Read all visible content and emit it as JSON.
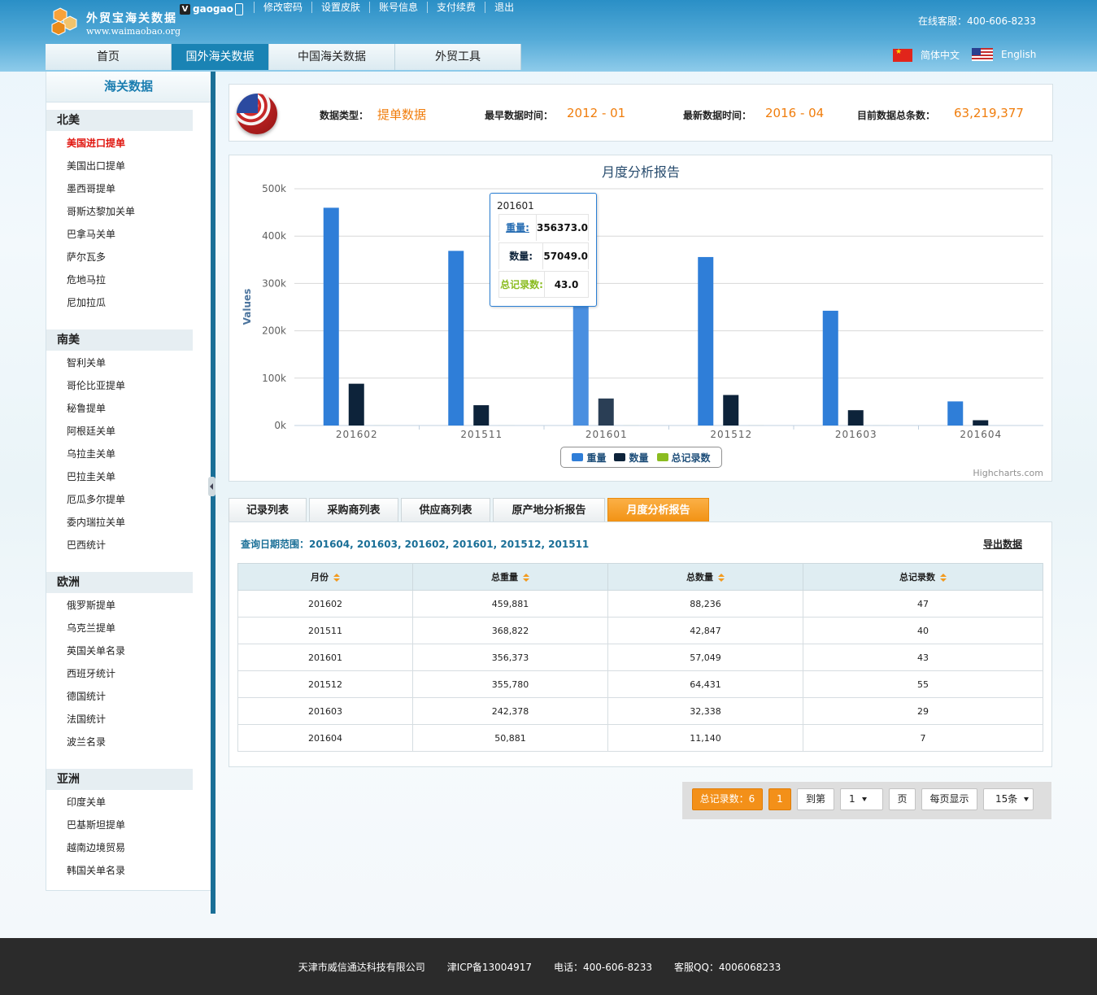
{
  "header": {
    "logo_title": "外贸宝海关数据",
    "logo_url": "www.waimaobao.org",
    "username": "gaogao",
    "user_badge": "V",
    "links": [
      "修改密码",
      "设置皮肤",
      "账号信息",
      "支付续费",
      "退出"
    ],
    "service": "在线客服：400-606-8233",
    "nav": [
      "首页",
      "国外海关数据",
      "中国海关数据",
      "外贸工具"
    ],
    "lang_cn": "简体中文",
    "lang_en": "English"
  },
  "sidebar": {
    "title": "海关数据",
    "regions": [
      {
        "name": "北美",
        "items": [
          "美国进口提单",
          "美国出口提单",
          "墨西哥提单",
          "哥斯达黎加关单",
          "巴拿马关单",
          "萨尔瓦多",
          "危地马拉",
          "尼加拉瓜"
        ]
      },
      {
        "name": "南美",
        "items": [
          "智利关单",
          "哥伦比亚提单",
          "秘鲁提单",
          "阿根廷关单",
          "乌拉圭关单",
          "巴拉圭关单",
          "厄瓜多尔提单",
          "委内瑞拉关单",
          "巴西统计"
        ]
      },
      {
        "name": "欧洲",
        "items": [
          "俄罗斯提单",
          "乌克兰提单",
          "英国关单名录",
          "西班牙统计",
          "德国统计",
          "法国统计",
          "波兰名录"
        ]
      },
      {
        "name": "亚洲",
        "items": [
          "印度关单",
          "巴基斯坦提单",
          "越南边境贸易",
          "韩国关单名录"
        ]
      }
    ]
  },
  "info": {
    "type_label": "数据类型：",
    "type_value": "提单数据",
    "earliest_label": "最早数据时间：",
    "earliest_value": "2012 - 01",
    "latest_label": "最新数据时间：",
    "latest_value": "2016 - 04",
    "total_label": "目前数据总条数：",
    "total_value": "63,219,377"
  },
  "chart_data": {
    "type": "bar",
    "title": "月度分析报告",
    "ylabel": "Values",
    "xlabel": "",
    "categories": [
      "201602",
      "201511",
      "201601",
      "201512",
      "201603",
      "201604"
    ],
    "ylim": [
      0,
      500000
    ],
    "yticks": [
      "0k",
      "100k",
      "200k",
      "300k",
      "400k",
      "500k"
    ],
    "series": [
      {
        "name": "重量",
        "values": [
          459881,
          368822,
          356373,
          355780,
          242378,
          50881
        ]
      },
      {
        "name": "数量",
        "values": [
          88236,
          42847,
          57049,
          64431,
          32338,
          11140
        ]
      },
      {
        "name": "总记录数",
        "values": [
          47,
          40,
          43,
          55,
          29,
          7
        ]
      }
    ],
    "grid": true,
    "legend": "bottom-center",
    "credits": "Highcharts.com"
  },
  "tooltip": {
    "title": "201601",
    "rows": [
      {
        "label": "重量:",
        "value": "356373.0"
      },
      {
        "label": "数量:",
        "value": "57049.0"
      },
      {
        "label": "总记录数:",
        "value": "43.0"
      }
    ]
  },
  "colors": {
    "weight": "#2f7ed8",
    "qty": "#0d233a",
    "records": "#8bbc21",
    "accent": "#f39019",
    "brand": "#1a83b4"
  },
  "tabs": [
    "记录列表",
    "采购商列表",
    "供应商列表",
    "原产地分析报告",
    "月度分析报告"
  ],
  "list": {
    "range_label": "查询日期范围：",
    "range_value": "201604, 201603, 201602, 201601, 201512, 201511",
    "export": "导出数据",
    "headers": [
      "月份",
      "总重量",
      "总数量",
      "总记录数"
    ],
    "rows": [
      [
        "201602",
        "459,881",
        "88,236",
        "47"
      ],
      [
        "201511",
        "368,822",
        "42,847",
        "40"
      ],
      [
        "201601",
        "356,373",
        "57,049",
        "43"
      ],
      [
        "201512",
        "355,780",
        "64,431",
        "55"
      ],
      [
        "201603",
        "242,378",
        "32,338",
        "29"
      ],
      [
        "201604",
        "50,881",
        "11,140",
        "7"
      ]
    ]
  },
  "pager": {
    "total": "总记录数：6",
    "current": "1",
    "goto": "到第",
    "page_select": "1",
    "page_unit": "页",
    "per_page": "每页显示",
    "per_page_select": "15条"
  },
  "footer": {
    "company": "天津市威信通达科技有限公司",
    "icp": "津ICP备13004917",
    "phone": "电话：400-606-8233",
    "qq": "客服QQ：4006068233"
  }
}
